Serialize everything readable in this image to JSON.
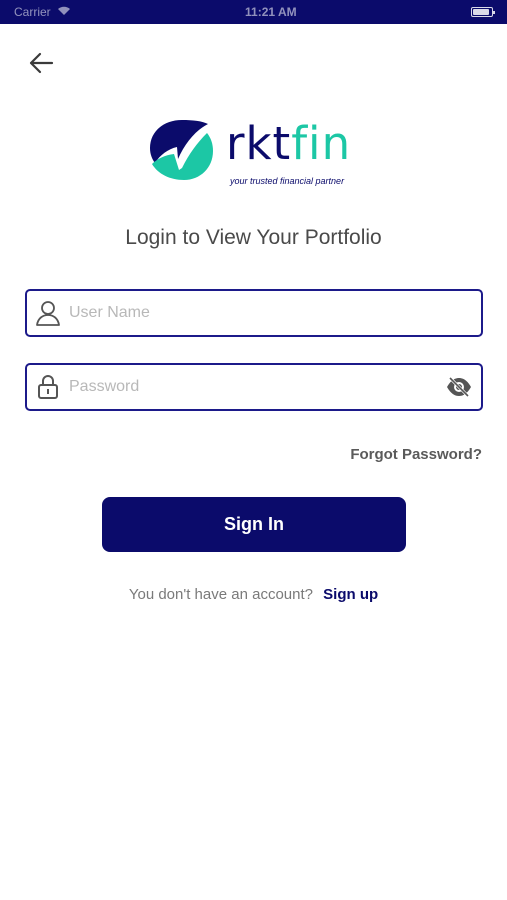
{
  "status_bar": {
    "carrier": "Carrier",
    "time": "11:21 AM"
  },
  "header": {
    "back_icon": "arrow-left-icon"
  },
  "logo": {
    "word_part1": "rkt",
    "word_part2": "fin",
    "tagline": "your trusted financial partner",
    "colors": {
      "primary": "#0b0b6b",
      "accent": "#1cc7a5"
    }
  },
  "page": {
    "title": "Login to View Your Portfolio"
  },
  "form": {
    "username": {
      "placeholder": "User Name",
      "value": "",
      "icon": "user-icon"
    },
    "password": {
      "placeholder": "Password",
      "value": "",
      "icon": "lock-icon",
      "toggle_icon": "eye-slash-icon"
    },
    "forgot_label": "Forgot Password?",
    "signin_label": "Sign In"
  },
  "signup": {
    "prompt": "You don't have an account?",
    "link_label": "Sign up"
  },
  "colors": {
    "brand": "#0b0b6b",
    "field_border": "#1c1a8a",
    "background": "#ffffff"
  }
}
